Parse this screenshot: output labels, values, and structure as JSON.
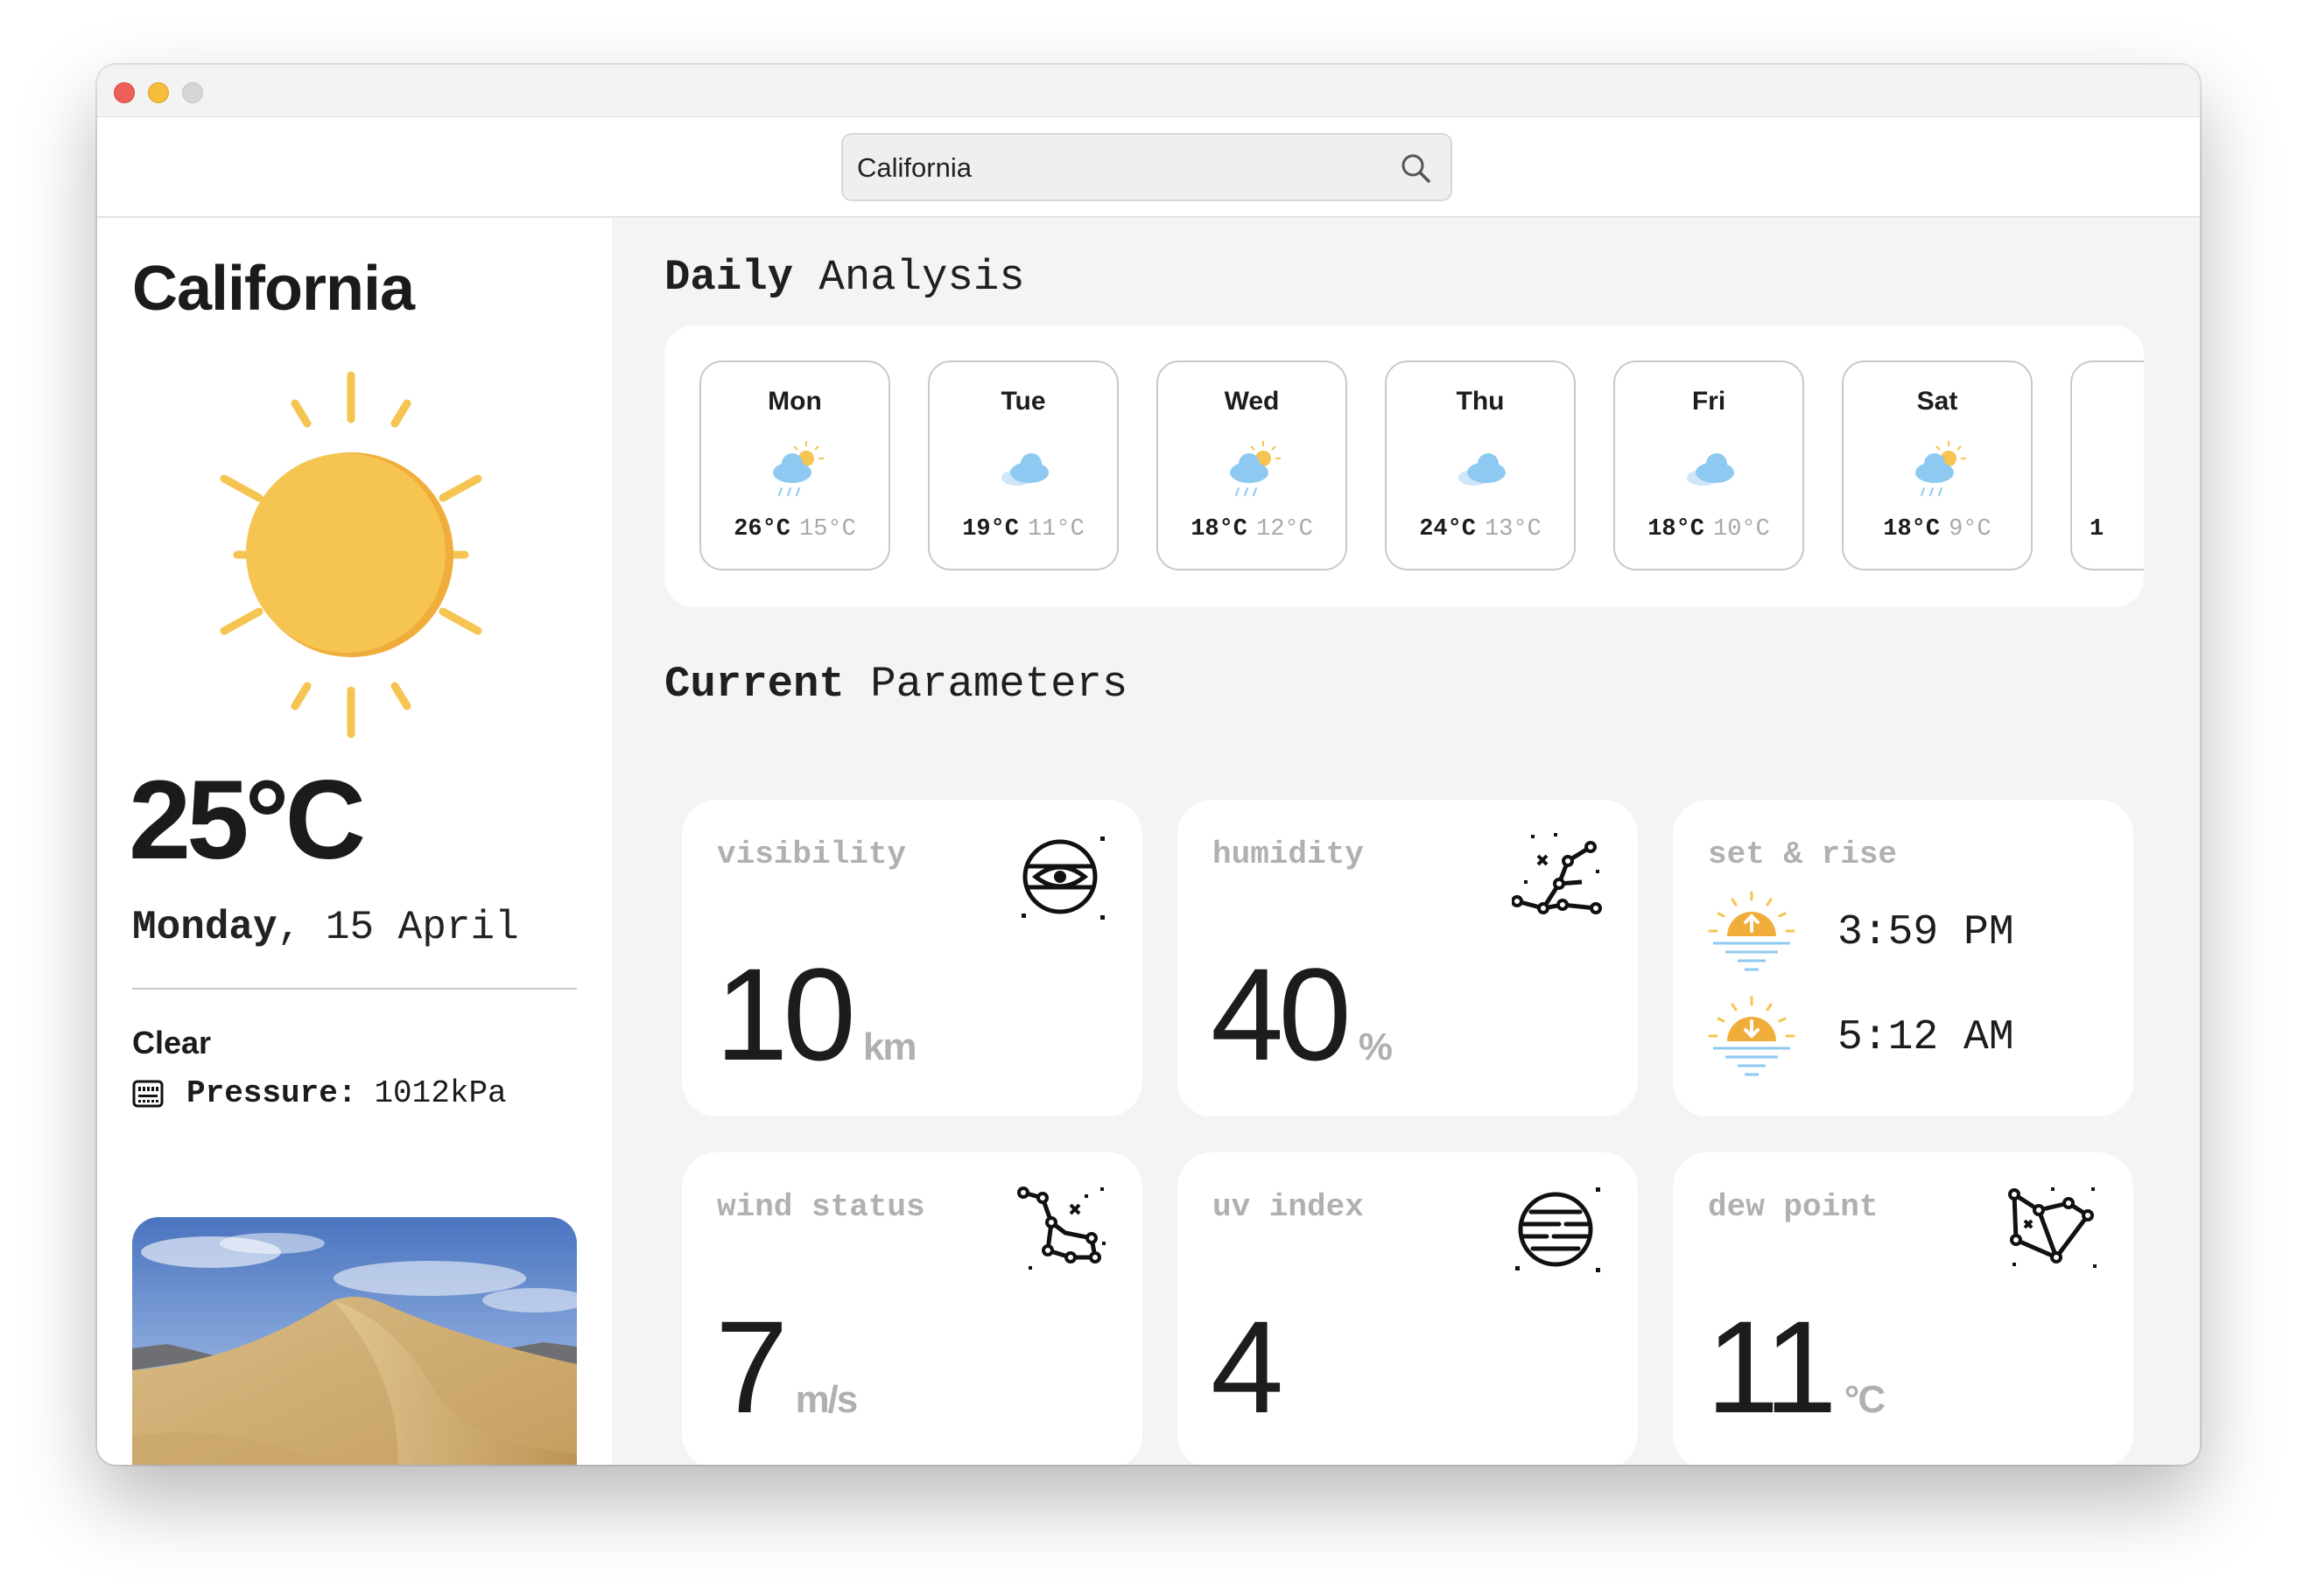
{
  "window": {
    "traffic_lights": [
      "close",
      "minimize",
      "zoom"
    ]
  },
  "search": {
    "value": "California",
    "icon": "search-icon"
  },
  "sidebar": {
    "city": "California",
    "weather_icon": "sun-icon",
    "temperature": "25°C",
    "day_name": "Monday",
    "date_rest": ", 15 April",
    "condition": "Clear",
    "pressure_icon": "barometer-icon",
    "pressure_label": "Pressure:",
    "pressure_value": "1012kPa",
    "image": "desert-dune-photo"
  },
  "daily": {
    "title_bold": "Daily",
    "title_rest": " Analysis",
    "days": [
      {
        "name": "Mon",
        "icon": "sun-cloud-rain-icon",
        "high": "26°C",
        "low": "15°C"
      },
      {
        "name": "Tue",
        "icon": "cloud-icon",
        "high": "19°C",
        "low": "11°C"
      },
      {
        "name": "Wed",
        "icon": "sun-cloud-rain-icon",
        "high": "18°C",
        "low": "12°C"
      },
      {
        "name": "Thu",
        "icon": "cloud-icon",
        "high": "24°C",
        "low": "13°C"
      },
      {
        "name": "Fri",
        "icon": "cloud-icon",
        "high": "18°C",
        "low": "10°C"
      },
      {
        "name": "Sat",
        "icon": "sun-cloud-rain-icon",
        "high": "18°C",
        "low": "9°C"
      },
      {
        "name": "",
        "icon": "",
        "high": "1",
        "low": ""
      }
    ]
  },
  "current": {
    "title_bold": "Current",
    "title_rest": " Parameters",
    "visibility": {
      "label": "visibility",
      "value": "10",
      "unit": "km",
      "icon": "eye-planet-icon"
    },
    "humidity": {
      "label": "humidity",
      "value": "40",
      "unit": "%",
      "icon": "constellation-icon"
    },
    "sunrise_sunset": {
      "label": "set & rise",
      "sunrise_time": "3:59 PM",
      "sunset_time": "5:12 AM",
      "sunrise_icon": "sunrise-icon",
      "sunset_icon": "sunset-icon"
    },
    "wind": {
      "label": "wind status",
      "value": "7",
      "unit": "m/s",
      "icon": "constellation-icon"
    },
    "uv": {
      "label": "uv index",
      "value": "4",
      "unit": "",
      "icon": "striped-planet-icon"
    },
    "dew": {
      "label": "dew point",
      "value": "11",
      "unit": "°C",
      "icon": "constellation-icon"
    }
  },
  "colors": {
    "sun": "#f5c451",
    "sun_shadow": "#f0ad3a",
    "cloud": "#8ec9f2",
    "muted_text": "#b0b0b0",
    "main_bg": "#f4f4f4"
  }
}
